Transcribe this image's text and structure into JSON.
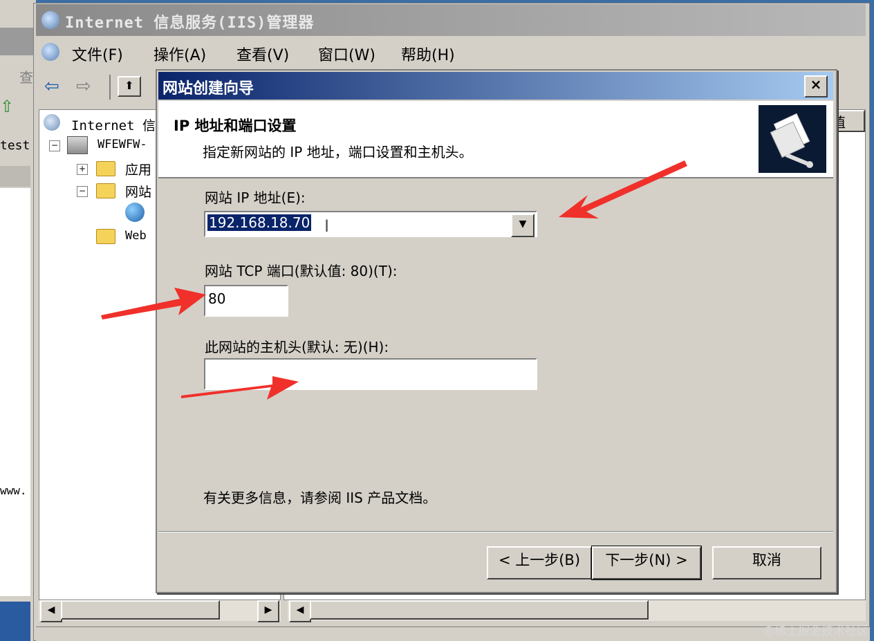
{
  "window": {
    "title": "Internet 信息服务(IIS)管理器",
    "menu": [
      "文件(F)",
      "操作(A)",
      "查看(V)",
      "窗口(W)",
      "帮助(H)"
    ]
  },
  "background_window": {
    "fragments": [
      "查",
      "test",
      "www."
    ]
  },
  "tree": {
    "root": "Internet 信",
    "server": "WFEWFW-",
    "children": [
      "应用",
      "网站",
      "Web"
    ]
  },
  "right_pane": {
    "column_fragment": "值"
  },
  "dialog": {
    "title": "网站创建向导",
    "close_label": "×",
    "header_title": "IP 地址和端口设置",
    "header_subtitle": "指定新网站的 IP 地址，端口设置和主机头。",
    "ip_label": "网站 IP 地址(E):",
    "ip_value": "192.168.18.70",
    "port_label": "网站 TCP 端口(默认值: 80)(T):",
    "port_value": "80",
    "host_label": "此网站的主机头(默认: 无)(H):",
    "host_value": "",
    "info_text": "有关更多信息，请参阅 IIS 产品文档。",
    "back_button": "< 上一步(B)",
    "next_button": "下一步(N) >",
    "cancel_button": "取消"
  },
  "watermark": "@稀土掘金技术社区",
  "annotation_color": "#f0302a"
}
